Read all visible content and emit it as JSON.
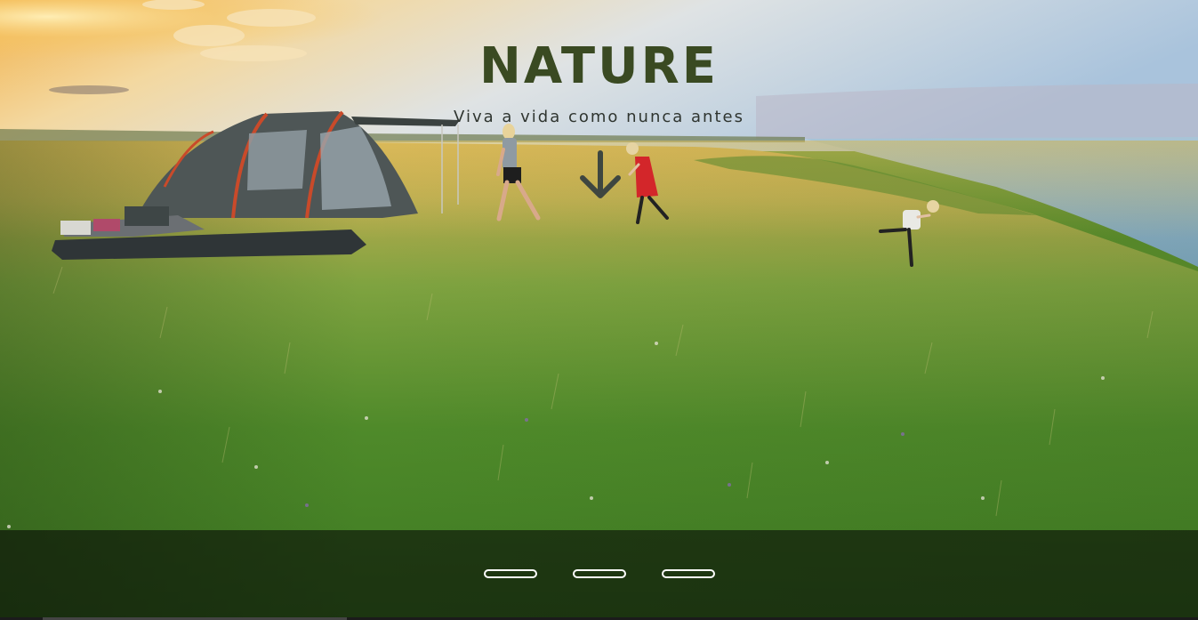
{
  "hero": {
    "title": "NATURE",
    "subtitle": "Viva a vida como nunca antes",
    "scroll_icon": "arrow-down-icon",
    "background_image": "camping-meadow-by-sea-photo"
  },
  "carousel": {
    "slide_count": 3,
    "active_index": 0
  },
  "colors": {
    "title": "#3a4a22",
    "subtitle": "#2f3530",
    "arrow": "#3e4640",
    "indicator": "#ffffff",
    "overlay": "#080c06"
  }
}
